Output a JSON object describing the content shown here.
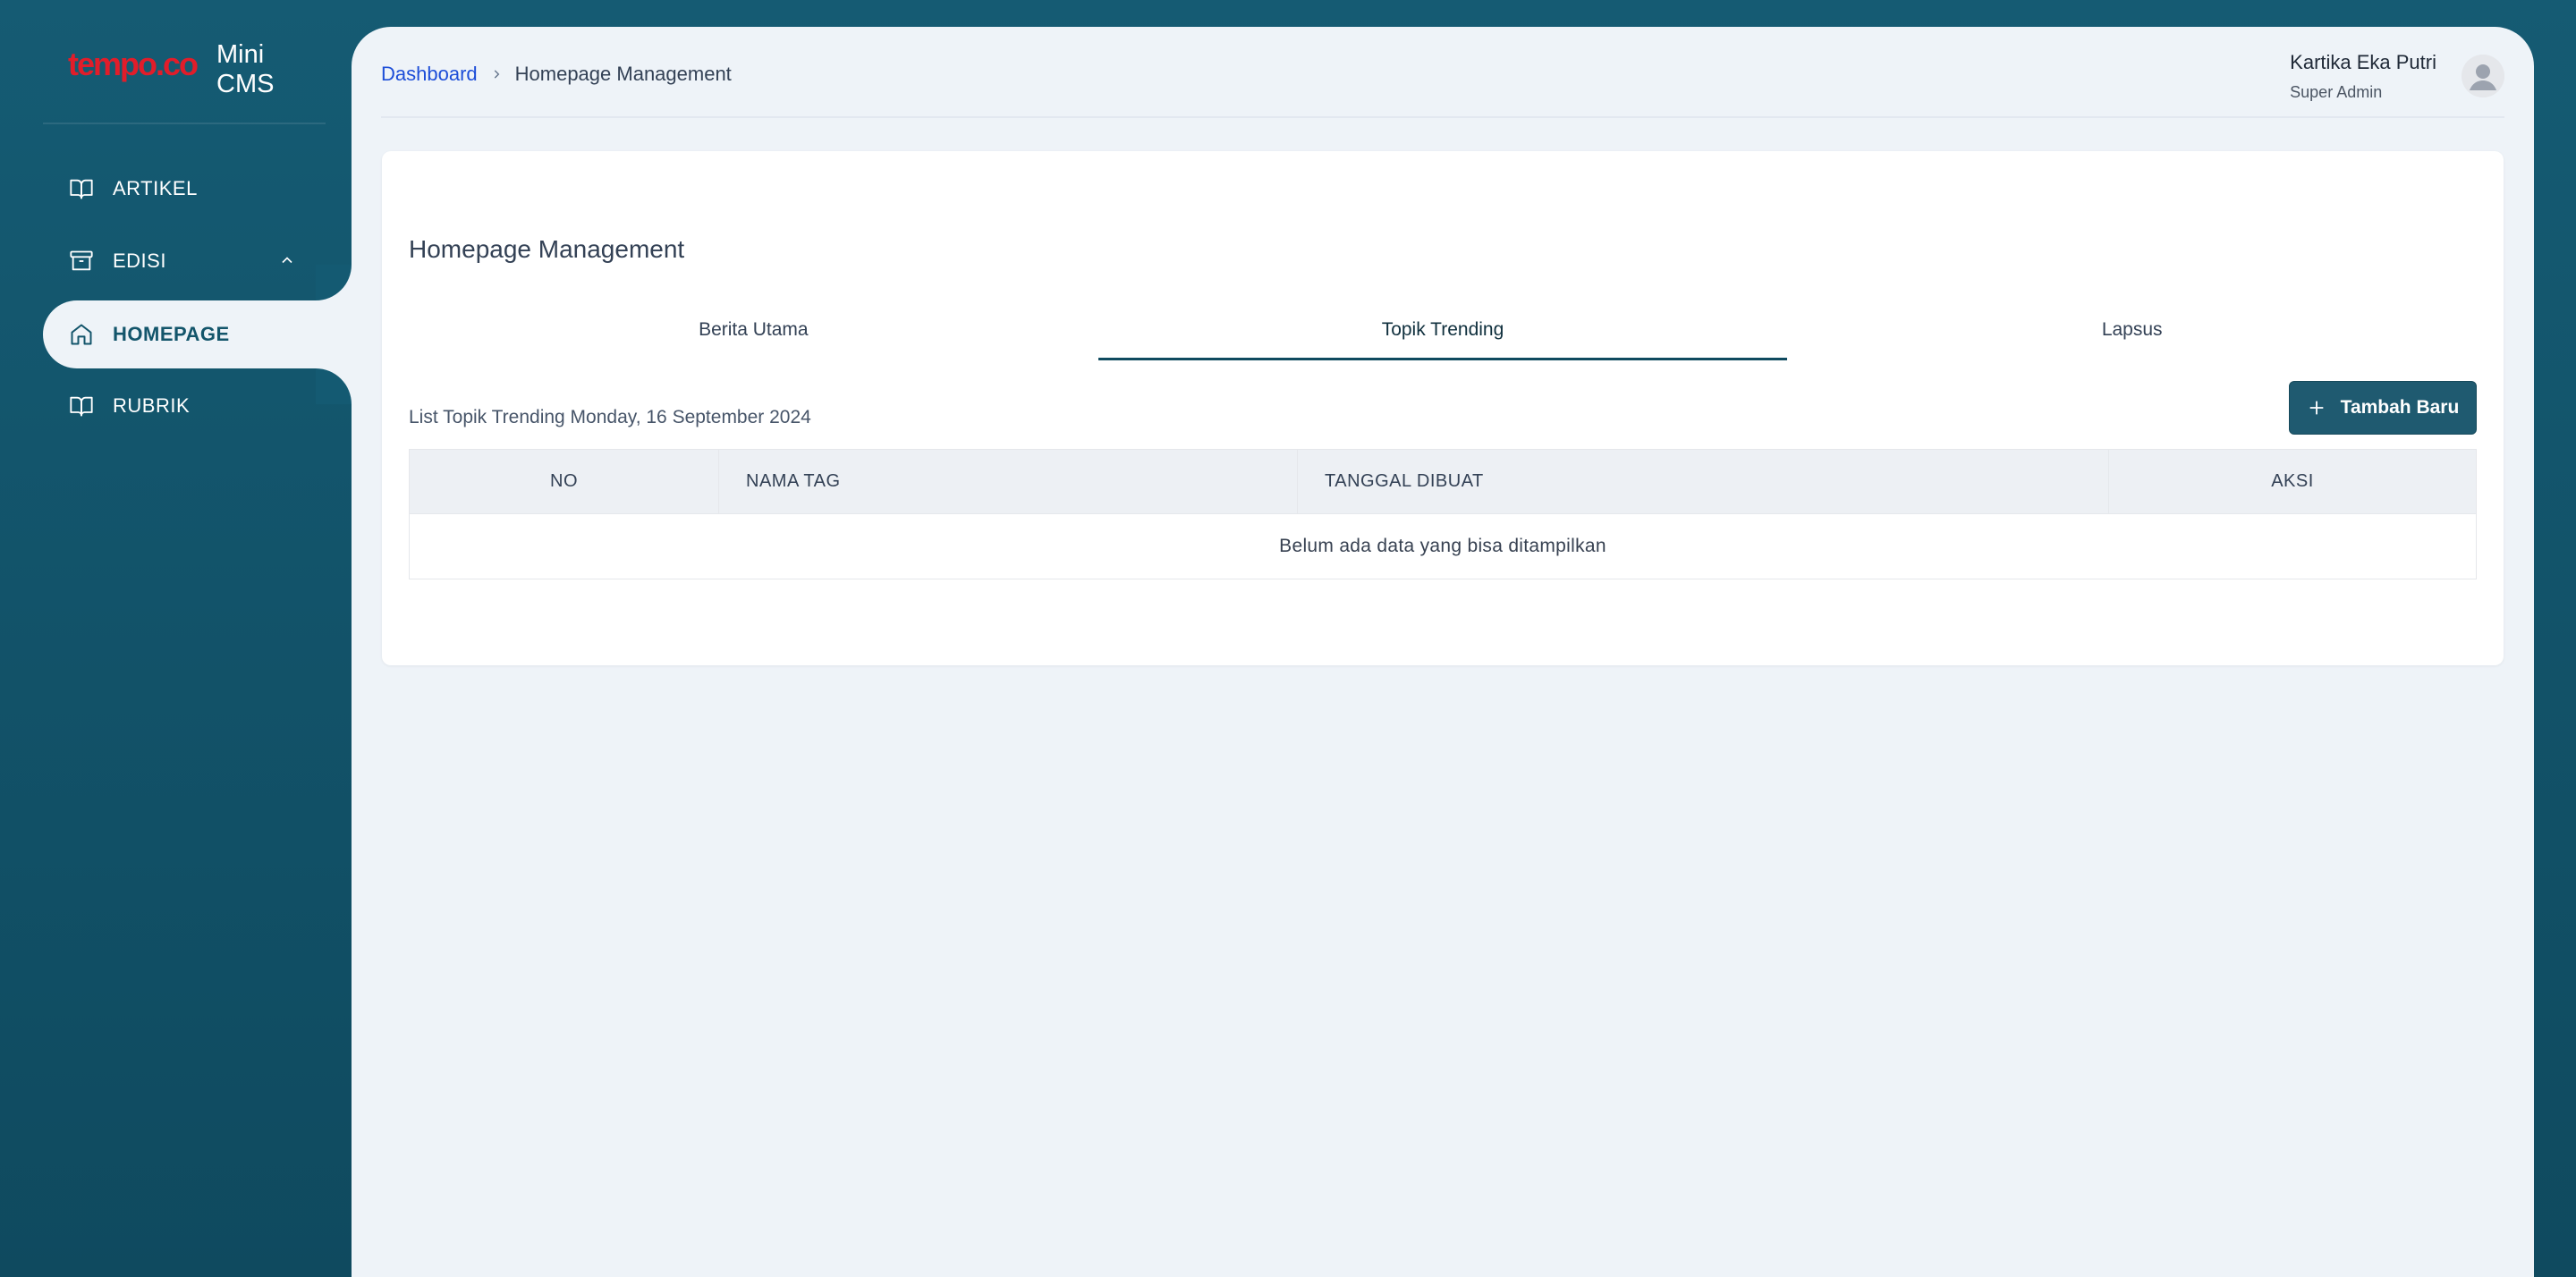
{
  "brand": {
    "logo_text": "tempo.co",
    "app_name": "Mini CMS"
  },
  "sidebar": {
    "items": [
      {
        "label": "ARTIKEL",
        "icon": "book-open-icon"
      },
      {
        "label": "EDISI",
        "icon": "archive-box-icon",
        "expanded": true
      },
      {
        "label": "HOMEPAGE",
        "icon": "home-icon",
        "active": true
      },
      {
        "label": "RUBRIK",
        "icon": "book-open-icon"
      }
    ]
  },
  "breadcrumb": {
    "root": "Dashboard",
    "current": "Homepage Management"
  },
  "user": {
    "name": "Kartika Eka Putri",
    "role": "Super Admin"
  },
  "card": {
    "title": "Homepage Management",
    "tabs": [
      {
        "label": "Berita Utama"
      },
      {
        "label": "Topik Trending",
        "active": true
      },
      {
        "label": "Lapsus"
      }
    ],
    "list_caption": "List Topik Trending Monday, 16 September 2024",
    "add_button": "Tambah Baru",
    "table": {
      "columns": [
        "NO",
        "NAMA TAG",
        "TANGGAL DIBUAT",
        "AKSI"
      ],
      "rows": [],
      "empty_message": "Belum ada data yang bisa ditampilkan"
    }
  },
  "colors": {
    "sidebar_bg": "#155b73",
    "content_bg": "#eef3f8",
    "accent": "#1f5a70",
    "logo_red": "#e11d2a",
    "link": "#1d4ed8"
  }
}
